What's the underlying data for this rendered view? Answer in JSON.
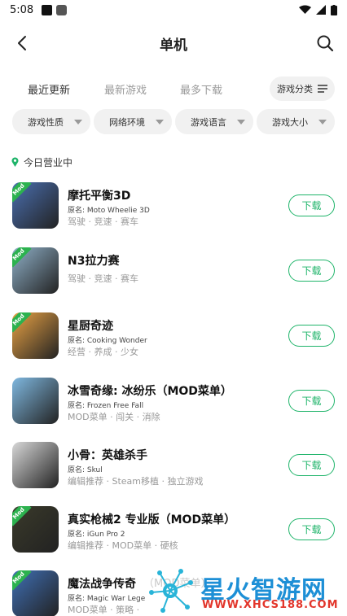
{
  "status_bar": {
    "time": "5:08"
  },
  "header": {
    "title": "单机"
  },
  "tabs": [
    {
      "label": "最近更新",
      "active": true
    },
    {
      "label": "最新游戏",
      "active": false
    },
    {
      "label": "最多下载",
      "active": false
    }
  ],
  "category_button": "游戏分类",
  "filters": [
    "游戏性质",
    "网络环境",
    "游戏语言",
    "游戏大小"
  ],
  "section_label": "今日营业中",
  "download_label": "下载",
  "games": [
    {
      "title": "摩托平衡3D",
      "orig": "原名: Moto Wheelie 3D",
      "tags": "驾驶 · 竞速 · 赛车",
      "mod": true,
      "icon": "motorbike-game-icon",
      "color": "#4a6fb0"
    },
    {
      "title": "N3拉力赛",
      "orig": "",
      "tags": "驾驶 · 竞速 · 赛车",
      "mod": true,
      "icon": "bus-game-icon",
      "color": "#8fb0c8"
    },
    {
      "title": "星厨奇迹",
      "orig": "原名: Cooking Wonder",
      "tags": "经营 · 养成 · 少女",
      "mod": true,
      "icon": "cooking-game-icon",
      "color": "#e9a244"
    },
    {
      "title": "冰雪奇缘: 冰纷乐（MOD菜单）",
      "orig": "原名: Frozen Free Fall",
      "tags": "MOD菜单 · 闯关 · 消除",
      "mod": false,
      "icon": "frozen-game-icon",
      "color": "#7fb8e0"
    },
    {
      "title": "小骨：英雄杀手",
      "orig": "原名: Skul",
      "tags": "编辑推荐 · Steam移植 · 独立游戏",
      "mod": false,
      "icon": "skull-game-icon",
      "color": "#d8d8d8"
    },
    {
      "title": "真实枪械2 专业版（MOD菜单）",
      "orig": "原名: iGun Pro 2",
      "tags": "编辑推荐 · MOD菜单 · 硬核",
      "mod": true,
      "icon": "gun-game-icon",
      "color": "#3a3a2a"
    },
    {
      "title": "魔法战争传奇",
      "orig": "原名: Magic War Lege",
      "tags": "MOD菜单 · 策略 · ",
      "mod": true,
      "icon": "shield-game-icon",
      "color": "#3f6fb5"
    }
  ],
  "watermark": {
    "text": "星火智游网",
    "url": "WWW.XHCS188.COM"
  },
  "partial_title_suffix": "（MOD菜单）",
  "colors": {
    "accent": "#1fb46a",
    "mod_badge": "#2cb24f"
  }
}
